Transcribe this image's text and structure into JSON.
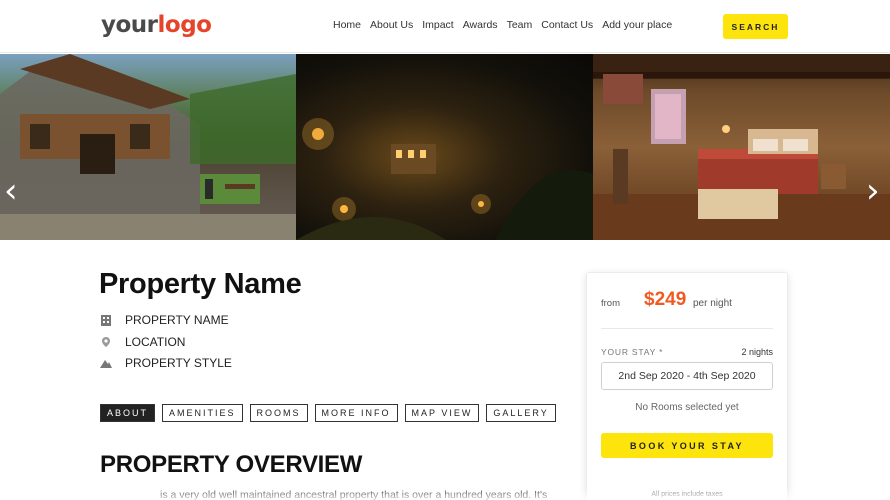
{
  "header": {
    "logo_part1": "your",
    "logo_part2": "logo",
    "nav": [
      "Home",
      "About Us",
      "Impact",
      "Awards",
      "Team",
      "Contact Us",
      "Add your place"
    ],
    "search_label": "SEARCH"
  },
  "carousel": {
    "slide_count": 3,
    "active_dot": 2,
    "dot_count": 3
  },
  "property": {
    "title": "Property Name",
    "name_label": "PROPERTY NAME",
    "location_label": "LOCATION",
    "style_label": "PROPERTY STYLE"
  },
  "tabs": [
    {
      "label": "ABOUT",
      "active": true
    },
    {
      "label": "AMENITIES",
      "active": false
    },
    {
      "label": "ROOMS",
      "active": false
    },
    {
      "label": "MORE INFO",
      "active": false
    },
    {
      "label": "MAP VIEW",
      "active": false
    },
    {
      "label": "GALLERY",
      "active": false
    }
  ],
  "overview": {
    "heading": "PROPERTY OVERVIEW",
    "text": "is a very old well maintained ancestral property that is over a hundred years old. It's"
  },
  "booking": {
    "from_label": "from",
    "price": "$249",
    "per_night": "per night",
    "stay_label": "YOUR STAY *",
    "nights": "2 nights",
    "dates": "2nd Sep 2020 - 4th Sep 2020",
    "no_rooms": "No Rooms selected yet",
    "book_label": "BOOK YOUR STAY",
    "taxes_note": "All prices include taxes"
  },
  "colors": {
    "accent_yellow": "#fde40c",
    "price_orange": "#f05a22",
    "logo_red": "#e5442b"
  }
}
